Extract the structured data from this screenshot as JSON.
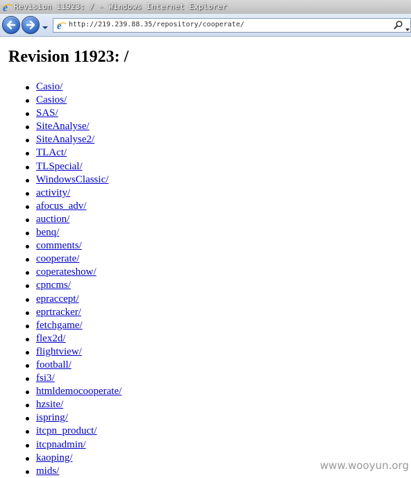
{
  "window": {
    "title": "Revision 11923: / - Windows Internet Explorer"
  },
  "address_bar": {
    "url": "http://219.239.88.35/repository/cooperate/"
  },
  "page": {
    "heading": "Revision 11923: /",
    "items": [
      "Casio/",
      "Casios/",
      "SAS/",
      "SiteAnalyse/",
      "SiteAnalyse2/",
      "TLAct/",
      "TLSpecial/",
      "WindowsClassic/",
      "activity/",
      "afocus_adv/",
      "auction/",
      "benq/",
      "comments/",
      "cooperate/",
      "coperateshow/",
      "cpncms/",
      "epraccept/",
      "eprtracker/",
      "fetchgame/",
      "flex2d/",
      "flightview/",
      "football/",
      "fsi3/",
      "htmldemocooperate/",
      "hzsite/",
      "ispring/",
      "itcpn_product/",
      "itcpnadmin/",
      "kaoping/",
      "mids/"
    ]
  },
  "watermark": "www.wooyun.org",
  "icons": {
    "title": "ie-logo-icon",
    "back": "back-arrow-icon",
    "forward": "forward-arrow-icon",
    "page": "ie-page-icon",
    "search": "search-icon"
  }
}
